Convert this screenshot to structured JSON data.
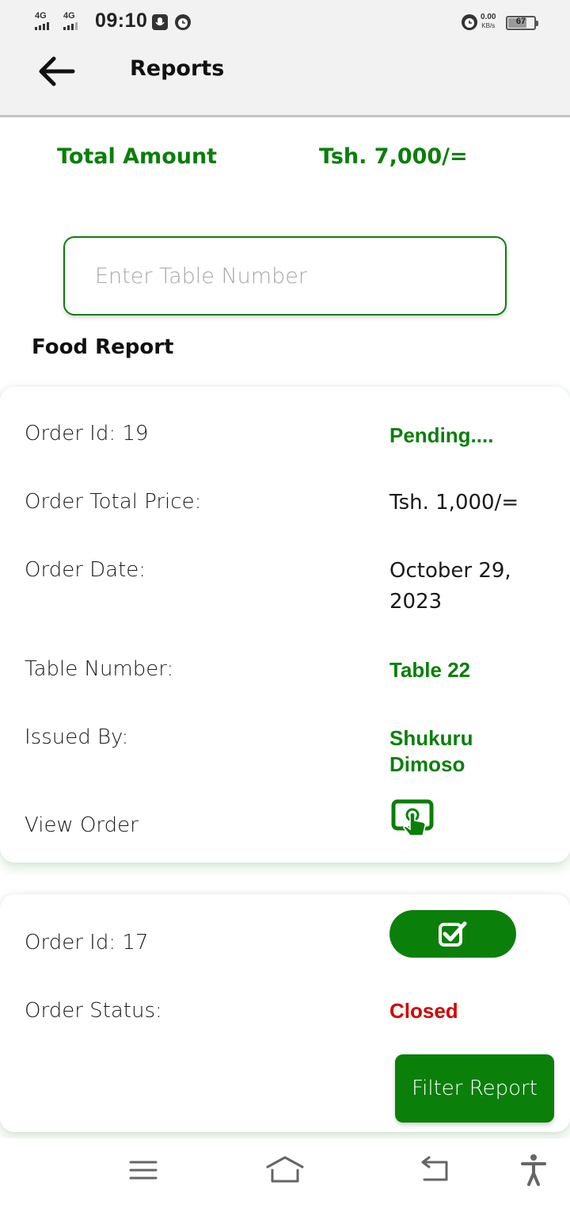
{
  "status_bar": {
    "network_1": "4G",
    "network_2": "4G",
    "time": "09:10",
    "speed_value": "0.00",
    "speed_unit": "KB/s",
    "battery_level": "67",
    "battery_fraction": 0.67
  },
  "header": {
    "title": "Reports",
    "back_icon": "arrow-left-icon"
  },
  "summary": {
    "total_label": "Total Amount",
    "total_value": "Tsh. 7,000/="
  },
  "search": {
    "placeholder": "Enter Table Number",
    "value": ""
  },
  "section_title": "Food Report",
  "orders": [
    {
      "order_id": "Order Id: 19",
      "status": "Pending....",
      "total_price_label": "Order Total Price:",
      "total_price": "Tsh. 1,000/=",
      "date_label": "Order Date:",
      "date": "October 29, 2023",
      "table_label": "Table Number:",
      "table": "Table 22",
      "issued_by_label": "Issued By:",
      "issued_by": "Shukuru Dimoso",
      "view_order_label": "View Order",
      "view_icon": "touch-screen-icon"
    },
    {
      "order_id": "Order Id: 17",
      "action_icon": "check-square-icon",
      "status_label": "Order Status:",
      "status": "Closed"
    }
  ],
  "filter_button": "Filter Report",
  "nav": {
    "menu_icon": "menu-icon",
    "home_icon": "home-icon",
    "back_icon": "back-icon",
    "accessibility_icon": "accessibility-icon"
  },
  "colors": {
    "accent": "#0a7f0a",
    "closed": "#d40000",
    "bar_bg": "#f2f2f2"
  }
}
